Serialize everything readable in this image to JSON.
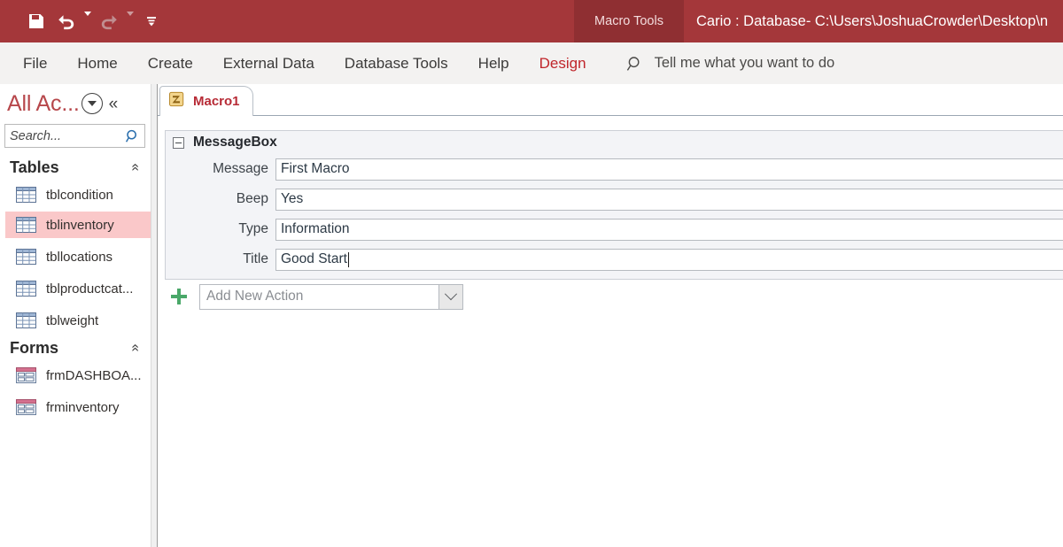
{
  "titlebar": {
    "quick_access": [
      {
        "name": "save-icon",
        "label": "Save",
        "enabled": true
      },
      {
        "name": "undo-icon",
        "label": "Undo",
        "enabled": true
      },
      {
        "name": "redo-icon",
        "label": "Redo",
        "enabled": false
      },
      {
        "name": "customize-quick-access-toolbar-icon",
        "label": "Customize Quick Access Toolbar",
        "enabled": true
      }
    ],
    "contextual_tab": "Macro Tools",
    "document_title": "Cario : Database- C:\\Users\\JoshuaCrowder\\Desktop\\n",
    "background_color": "#a4373a",
    "contextual_tab_color": "#8f2f32"
  },
  "ribbon": {
    "tabs": [
      {
        "label": "File",
        "active": false
      },
      {
        "label": "Home",
        "active": false
      },
      {
        "label": "Create",
        "active": false
      },
      {
        "label": "External Data",
        "active": false
      },
      {
        "label": "Database Tools",
        "active": false
      },
      {
        "label": "Help",
        "active": false
      },
      {
        "label": "Design",
        "active": true
      }
    ],
    "tell_me": "Tell me what you want to do",
    "active_tab_color": "#c0262b",
    "background_color": "#f3f2f1"
  },
  "navigation_pane": {
    "title": "All Ac...",
    "title_color": "#b7474b",
    "collapse_label": "«",
    "search": {
      "value": "",
      "placeholder": "Search..."
    },
    "groups": [
      {
        "label": "Tables",
        "collapse_label": "«",
        "items": [
          {
            "label": "tblcondition",
            "icon": "table-icon",
            "selected": false
          },
          {
            "label": "tblinventory",
            "icon": "table-icon",
            "selected": true
          },
          {
            "label": "tbllocations",
            "icon": "table-icon",
            "selected": false
          },
          {
            "label": "tblproductcat...",
            "icon": "table-icon",
            "selected": false
          },
          {
            "label": "tblweight",
            "icon": "table-icon",
            "selected": false
          }
        ]
      },
      {
        "label": "Forms",
        "collapse_label": "«",
        "items": [
          {
            "label": "frmDASHBOA...",
            "icon": "form-icon",
            "selected": false
          },
          {
            "label": "frminventory",
            "icon": "form-icon",
            "selected": false
          }
        ]
      }
    ],
    "selection_color": "#fac8c9"
  },
  "document": {
    "tabs": [
      {
        "label": "Macro1",
        "icon": "macro-icon",
        "active": true
      }
    ],
    "tab_label_color": "#b72b36",
    "macro_designer": {
      "action_block": {
        "title": "MessageBox",
        "expanded": true,
        "arguments": [
          {
            "label": "Message",
            "value": "First Macro",
            "focused": false
          },
          {
            "label": "Beep",
            "value": "Yes",
            "focused": false
          },
          {
            "label": "Type",
            "value": "Information",
            "focused": false
          },
          {
            "label": "Title",
            "value": "Good Start",
            "focused": true
          }
        ]
      },
      "add_new_action": {
        "add_icon": "plus-icon",
        "placeholder": "Add New Action",
        "value": "",
        "dropdown_icon": "chevron-down-icon"
      }
    }
  }
}
